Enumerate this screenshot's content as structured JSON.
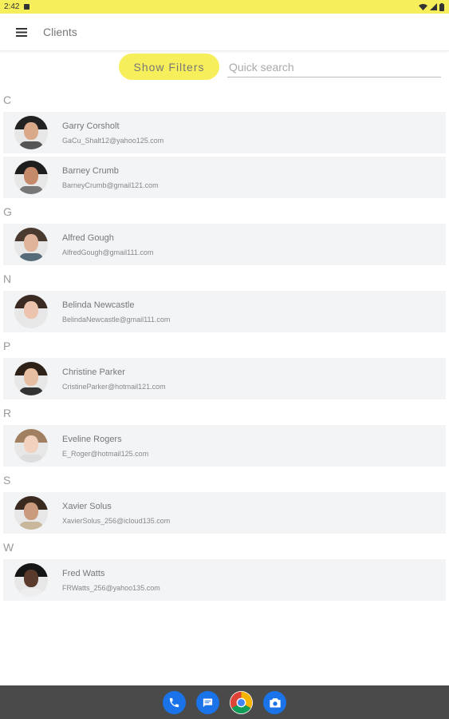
{
  "status_bar": {
    "time": "2:42"
  },
  "app_bar": {
    "title": "Clients",
    "menu_icon": "hamburger-menu-icon"
  },
  "filters": {
    "button_label": "Show Filters",
    "search_placeholder": "Quick search",
    "accent": "#f6ee5b"
  },
  "sections": [
    {
      "letter": "C",
      "clients": [
        {
          "name": "Garry Corsholt",
          "email": "GaCu_Shalt12@yahoo125.com",
          "skin": "#d9a98a",
          "hair": "#222222",
          "shirt": "#555555"
        },
        {
          "name": "Barney Crumb",
          "email": "BarneyCrumb@gmail121.com",
          "skin": "#c48a6a",
          "hair": "#1e1e1e",
          "shirt": "#777777"
        }
      ]
    },
    {
      "letter": "G",
      "clients": [
        {
          "name": "Alfred Gough",
          "email": "AlfredGough@gmail111.com",
          "skin": "#e0b49a",
          "hair": "#4a3a30",
          "shirt": "#556b7a"
        }
      ]
    },
    {
      "letter": "N",
      "clients": [
        {
          "name": "Belinda Newcastle",
          "email": "BelindaNewcastle@gmail111.com",
          "skin": "#ecc4ad",
          "hair": "#3a2a22",
          "shirt": "#e8e8e8"
        }
      ]
    },
    {
      "letter": "P",
      "clients": [
        {
          "name": "Christine Parker",
          "email": "CristineParker@hotmail121.com",
          "skin": "#e6bea2",
          "hair": "#2e2218",
          "shirt": "#333333"
        }
      ]
    },
    {
      "letter": "R",
      "clients": [
        {
          "name": "Eveline Rogers",
          "email": "E_Roger@hotmail125.com",
          "skin": "#f0d2bf",
          "hair": "#a08060",
          "shirt": "#dddddd"
        }
      ]
    },
    {
      "letter": "S",
      "clients": [
        {
          "name": "Xavier Solus",
          "email": "XavierSolus_256@icloud135.com",
          "skin": "#c99b7c",
          "hair": "#3a2a20",
          "shirt": "#c8b79a"
        }
      ]
    },
    {
      "letter": "W",
      "clients": [
        {
          "name": "Fred Watts",
          "email": "FRWatts_256@yahoo135.com",
          "skin": "#5a3a2a",
          "hair": "#151515",
          "shirt": "#eeeeee"
        }
      ]
    }
  ],
  "dock": [
    {
      "app": "phone",
      "icon": "phone-icon",
      "color": "#1a73e8"
    },
    {
      "app": "messages",
      "icon": "messages-icon",
      "color": "#1a73e8"
    },
    {
      "app": "chrome",
      "icon": "chrome-icon",
      "color": "#ffffff"
    },
    {
      "app": "camera",
      "icon": "camera-icon",
      "color": "#1a73e8"
    }
  ]
}
